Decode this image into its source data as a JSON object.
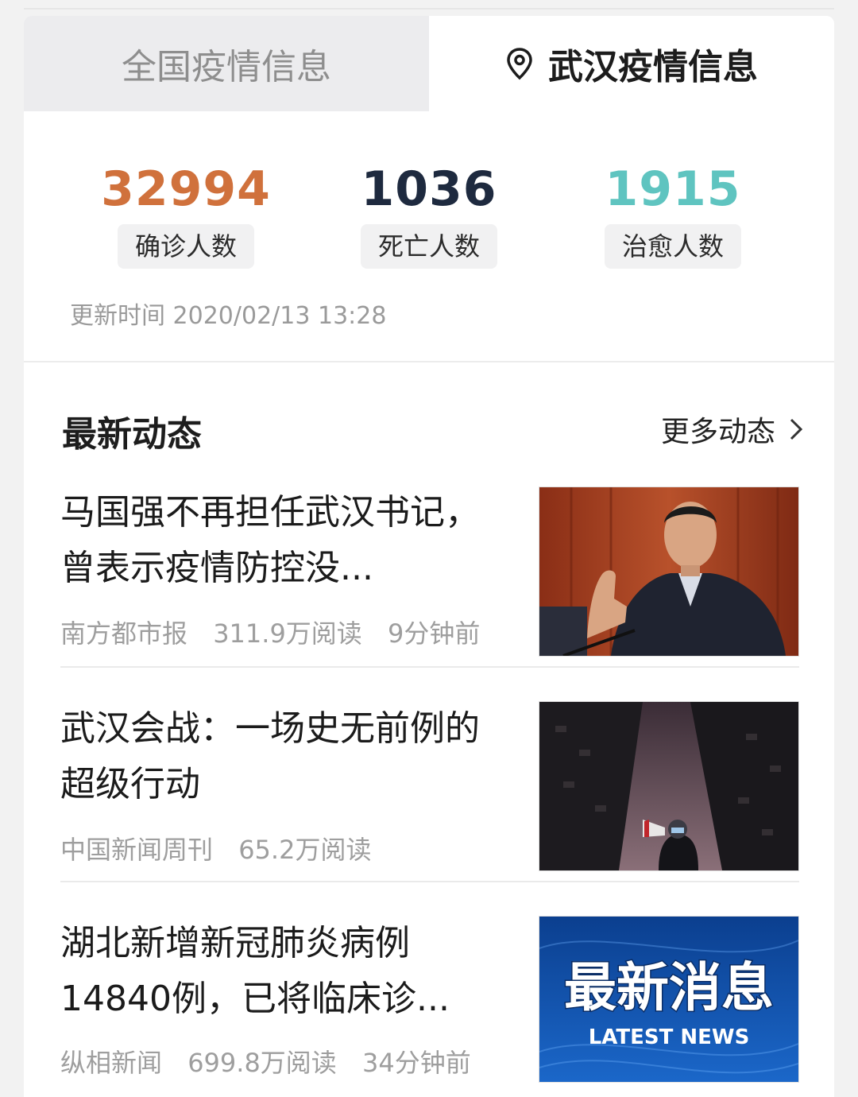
{
  "tabs": {
    "national": "全国疫情信息",
    "wuhan": "武汉疫情信息"
  },
  "stats": {
    "confirmed": {
      "value": "32994",
      "label": "确诊人数",
      "color": "#d0713c"
    },
    "death": {
      "value": "1036",
      "label": "死亡人数",
      "color": "#1e2a3f"
    },
    "cured": {
      "value": "1915",
      "label": "治愈人数",
      "color": "#5fc4c0"
    }
  },
  "update_time": "更新时间 2020/02/13 13:28",
  "latest": {
    "title": "最新动态",
    "more": "更多动态"
  },
  "news": [
    {
      "title": "马国强不再担任武汉书记，曾表示疫情防控没...",
      "source": "南方都市报",
      "reads": "311.9万阅读",
      "time": "9分钟前"
    },
    {
      "title": "武汉会战：一场史无前例的超级行动",
      "source": "中国新闻周刊",
      "reads": "65.2万阅读",
      "time": ""
    },
    {
      "title": "湖北新增新冠肺炎病例14840例，已将临床诊...",
      "source": "纵相新闻",
      "reads": "699.8万阅读",
      "time": "34分钟前",
      "thumb_text": "最新消息",
      "thumb_sub": "LATEST NEWS"
    }
  ]
}
